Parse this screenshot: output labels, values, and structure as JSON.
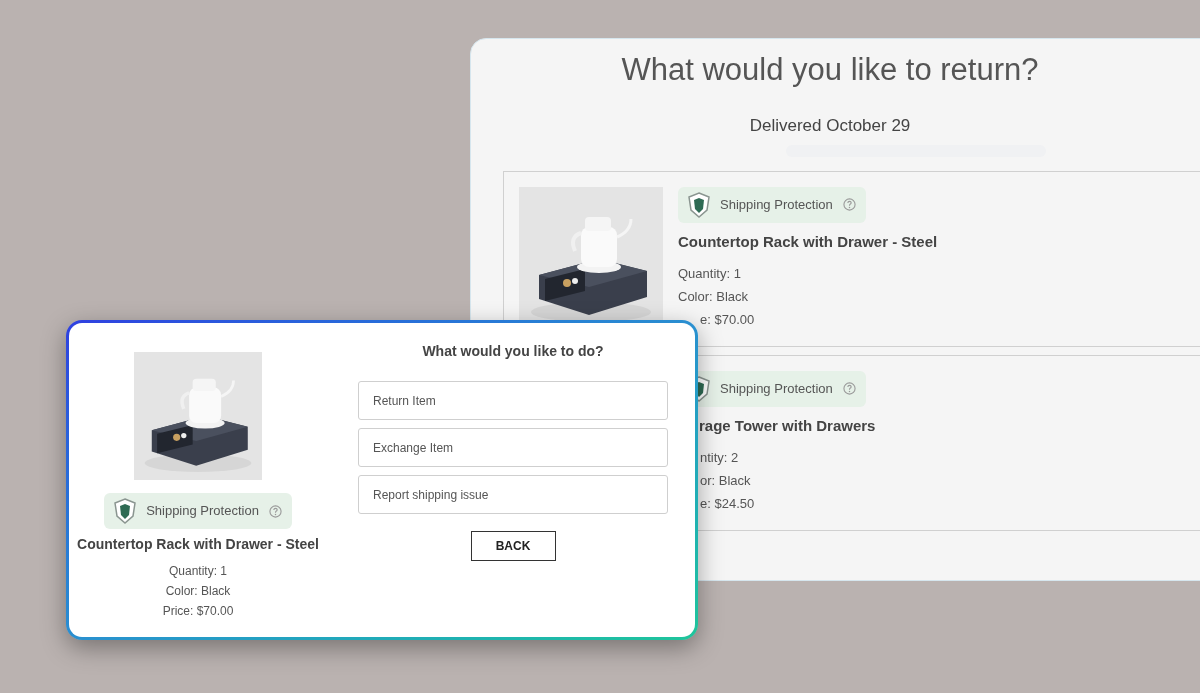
{
  "back_page": {
    "title": "What would you like to return?",
    "subtitle": "Delivered October 29",
    "items": [
      {
        "badge": "Shipping Protection",
        "name": "Countertop Rack with Drawer - Steel",
        "details": [
          "Quantity: 1",
          "Color: Black",
          "e: $70.00"
        ]
      },
      {
        "badge": "Shipping Protection",
        "name": "rage Tower with Drawers",
        "details": [
          "ntity: 2",
          "or: Black",
          "e: $24.50"
        ]
      }
    ]
  },
  "dialog": {
    "product": {
      "badge": "Shipping Protection",
      "name": "Countertop Rack with Drawer - Steel",
      "details": [
        "Quantity: 1",
        "Color: Black",
        "Price: $70.00"
      ]
    },
    "question": "What would you like to do?",
    "options": [
      "Return Item",
      "Exchange Item",
      "Report shipping issue"
    ],
    "back_button": "BACK"
  }
}
